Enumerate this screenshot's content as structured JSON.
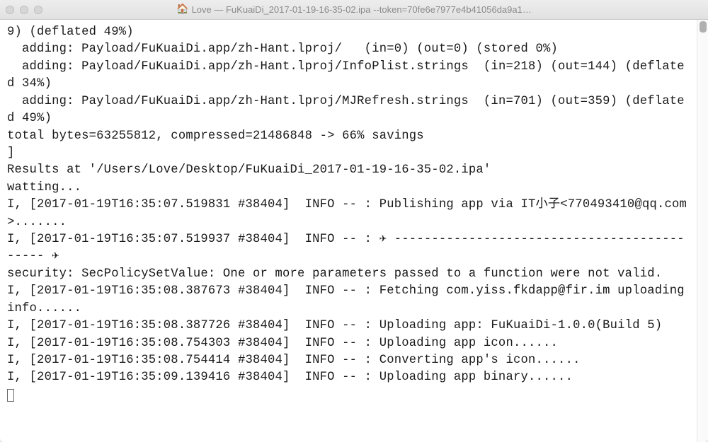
{
  "window": {
    "title": "Love — FuKuaiDi_2017-01-19-16-35-02.ipa --token=70fe6e7977e4b41056da9a1…",
    "title_icon": "🏠"
  },
  "terminal": {
    "lines": [
      "9) (deflated 49%)",
      "  adding: Payload/FuKuaiDi.app/zh-Hant.lproj/   (in=0) (out=0) (stored 0%)",
      "  adding: Payload/FuKuaiDi.app/zh-Hant.lproj/InfoPlist.strings  (in=218) (out=144) (deflated 34%)",
      "  adding: Payload/FuKuaiDi.app/zh-Hant.lproj/MJRefresh.strings  (in=701) (out=359) (deflated 49%)",
      "total bytes=63255812, compressed=21486848 -> 66% savings",
      "]",
      "Results at '/Users/Love/Desktop/FuKuaiDi_2017-01-19-16-35-02.ipa'",
      "watting...",
      "I, [2017-01-19T16:35:07.519831 #38404]  INFO -- : Publishing app via IT小子<770493410@qq.com>.......",
      "I, [2017-01-19T16:35:07.519937 #38404]  INFO -- : ✈ -------------------------------------------- ✈",
      "security: SecPolicySetValue: One or more parameters passed to a function were not valid.",
      "I, [2017-01-19T16:35:08.387673 #38404]  INFO -- : Fetching com.yiss.fkdapp@fir.im uploading info......",
      "I, [2017-01-19T16:35:08.387726 #38404]  INFO -- : Uploading app: FuKuaiDi-1.0.0(Build 5)",
      "I, [2017-01-19T16:35:08.754303 #38404]  INFO -- : Uploading app icon......",
      "I, [2017-01-19T16:35:08.754414 #38404]  INFO -- : Converting app's icon......",
      "I, [2017-01-19T16:35:09.139416 #38404]  INFO -- : Uploading app binary......"
    ]
  }
}
